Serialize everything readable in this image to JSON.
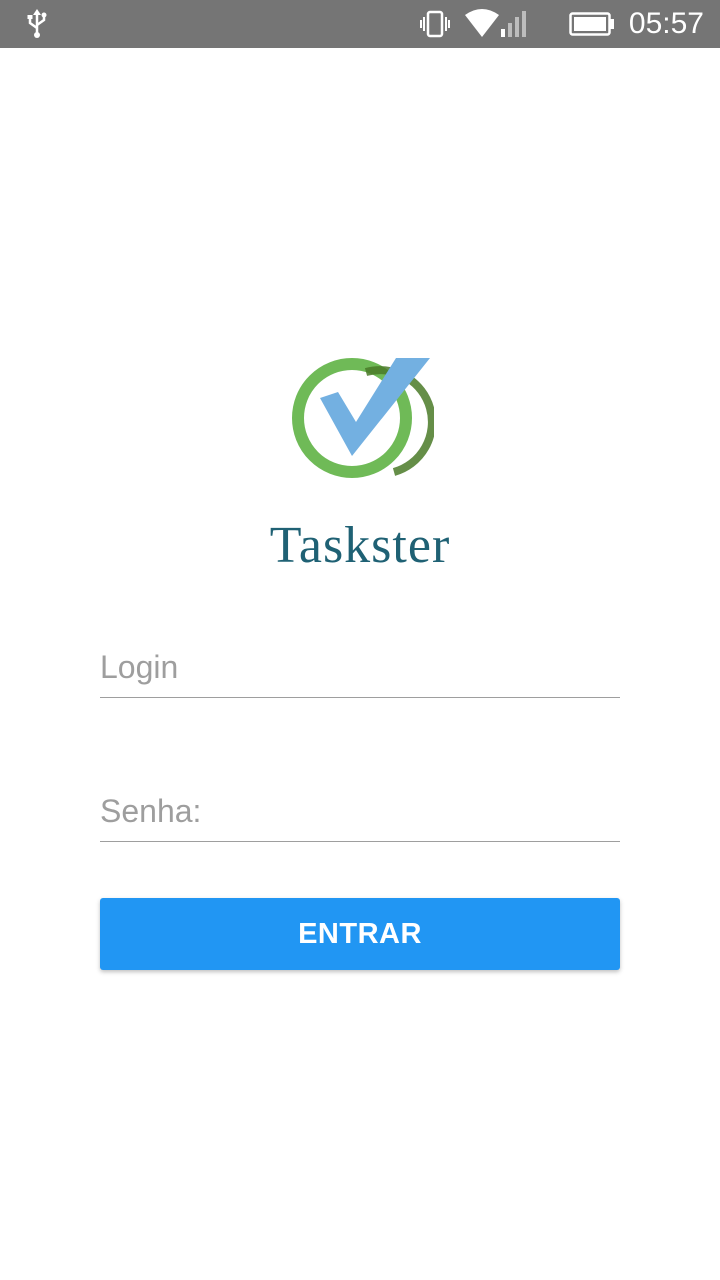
{
  "status_bar": {
    "time": "05:57",
    "icons": [
      "usb-icon",
      "vibrate-icon",
      "wifi-icon",
      "battery-icon"
    ],
    "background": "#757575"
  },
  "app": {
    "name": "Taskster",
    "logo": "check-circle-logo",
    "name_color": "#1f6174"
  },
  "form": {
    "login_placeholder": "Login",
    "login_value": "",
    "senha_placeholder": "Senha:",
    "senha_value": "",
    "submit_label": "ENTRAR",
    "button_color": "#2196f3"
  }
}
